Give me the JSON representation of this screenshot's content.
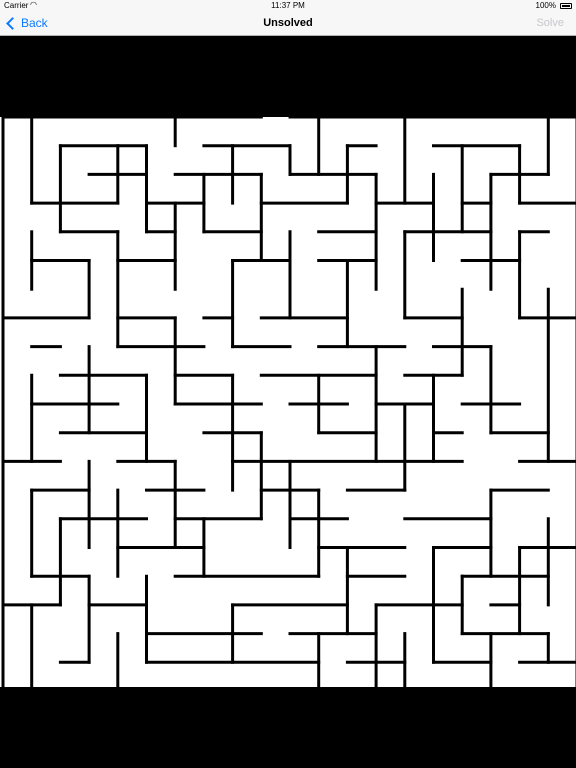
{
  "status_bar": {
    "carrier": "Carrier",
    "time": "11:37 PM",
    "battery": "100%"
  },
  "nav_bar": {
    "back_label": "Back",
    "title": "Unsolved",
    "solve_label": "Solve"
  },
  "colors": {
    "accent": "#0a7aff",
    "disabled": "#c7c7cc",
    "maze_wall": "#000000",
    "maze_path": "#ffffff"
  },
  "icons": [
    "back-chevron-icon",
    "wifi-icon",
    "battery-icon"
  ]
}
